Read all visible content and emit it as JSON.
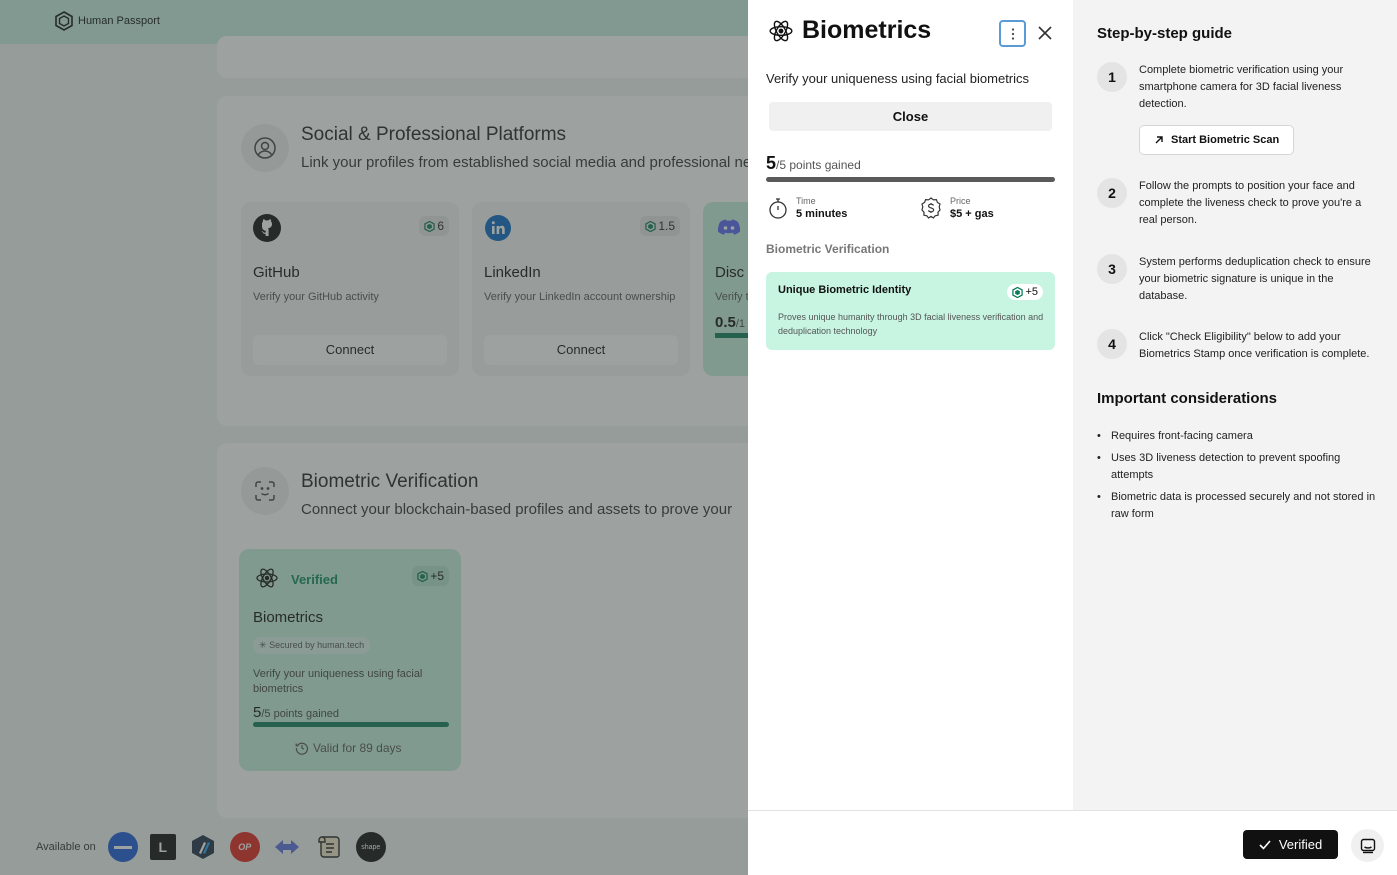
{
  "app": {
    "brand": "Human Passport"
  },
  "background": {
    "social": {
      "title": "Social & Professional Platforms",
      "subtitle": "Link your profiles from established social media and professional networks",
      "cards": [
        {
          "name": "GitHub",
          "points": "6",
          "desc": "Verify your GitHub activity",
          "button": "Connect"
        },
        {
          "name": "LinkedIn",
          "points": "1.5",
          "desc": "Verify your LinkedIn account ownership",
          "button": "Connect"
        },
        {
          "name": "Disc",
          "desc": "Verify t",
          "points_gained": "0.5",
          "points_gained_total": "/1"
        }
      ]
    },
    "biometric": {
      "title": "Biometric Verification",
      "subtitle": "Connect your blockchain-based profiles and assets to prove your",
      "card": {
        "status": "Verified",
        "points": "+5",
        "name": "Biometrics",
        "secured": "Secured by human.tech",
        "desc": "Verify your uniqueness using facial biometrics",
        "points_gained": "5",
        "points_total": "/5 points gained",
        "valid": "Valid for 89 days",
        "progress": 1.0
      }
    },
    "available": {
      "label": "Available on"
    }
  },
  "drawer": {
    "title": "Biometrics",
    "subtitle": "Verify your uniqueness using facial biometrics",
    "close_label": "Close",
    "points_gained": "5",
    "points_total": "/5 points gained",
    "progress": 1.0,
    "time_label": "Time",
    "time_value": "5 minutes",
    "price_label": "Price",
    "price_value": "$5 + gas",
    "section_heading": "Biometric Verification",
    "stamp": {
      "name": "Unique Biometric Identity",
      "points": "+5",
      "desc": "Proves unique humanity through 3D facial liveness verification and deduplication technology"
    },
    "guide": {
      "title": "Step-by-step guide",
      "steps": [
        {
          "num": "1",
          "text": "Complete biometric verification using your smartphone camera for 3D facial liveness detection."
        },
        {
          "num": "2",
          "text": "Follow the prompts to position your face and complete the liveness check to prove you're a real person."
        },
        {
          "num": "3",
          "text": "System performs deduplication check to ensure your biometric signature is unique in the database."
        },
        {
          "num": "4",
          "text": "Click \"Check Eligibility\" below to add your Biometrics Stamp once verification is complete."
        }
      ],
      "scan_button": "Start Biometric Scan",
      "considerations_title": "Important considerations",
      "considerations": [
        "Requires front-facing camera",
        "Uses 3D liveness detection to prevent spoofing attempts",
        "Biometric data is processed securely and not stored in raw form"
      ]
    },
    "footer": {
      "verified_label": "Verified"
    }
  },
  "colors": {
    "accent": "#0e7c5a",
    "mint": "#c7f5e2",
    "dark": "#111111"
  }
}
